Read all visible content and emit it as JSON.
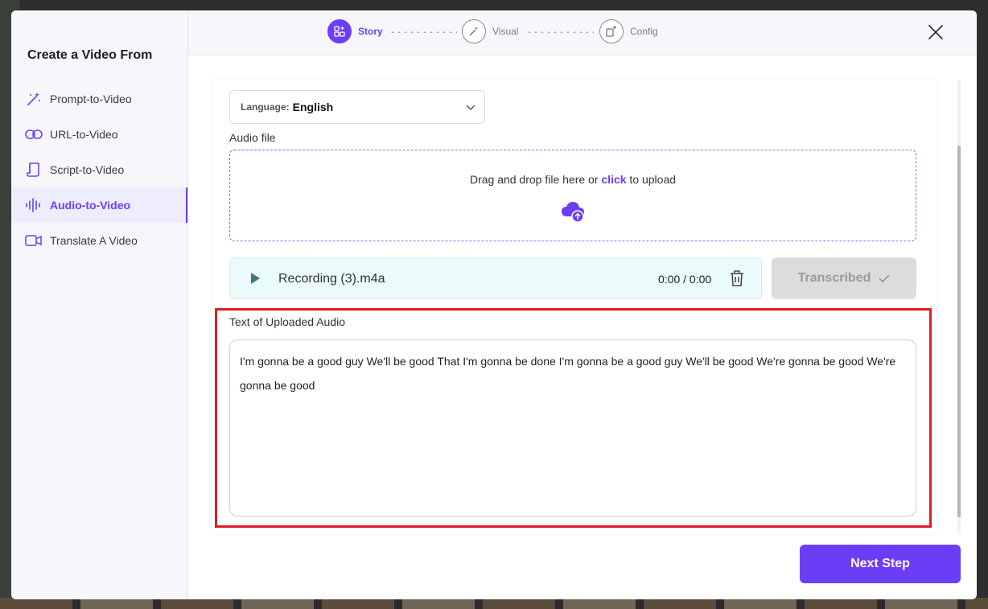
{
  "sidebar": {
    "title": "Create a Video From",
    "items": [
      {
        "label": "Prompt-to-Video",
        "icon": "magic-wand-icon"
      },
      {
        "label": "URL-to-Video",
        "icon": "link-icon"
      },
      {
        "label": "Script-to-Video",
        "icon": "scroll-icon"
      },
      {
        "label": "Audio-to-Video",
        "icon": "audio-wave-icon",
        "active": true
      },
      {
        "label": "Translate A Video",
        "icon": "video-camera-icon"
      }
    ]
  },
  "steps": [
    {
      "label": "Story",
      "icon": "story-icon",
      "active": true
    },
    {
      "label": "Visual",
      "icon": "visual-icon"
    },
    {
      "label": "Config",
      "icon": "config-icon"
    }
  ],
  "form": {
    "language_key": "Language:",
    "language_value": "English",
    "audio_file_label": "Audio file",
    "dropzone_text_before": "Drag and drop file here or ",
    "dropzone_click": "click",
    "dropzone_text_after": " to upload",
    "recording_name": "Recording (3).m4a",
    "recording_time": "0:00 / 0:00",
    "transcribed_label": "Transcribed",
    "text_label": "Text of Uploaded Audio",
    "transcript": "I'm gonna be a good guy We'll be good That I'm gonna be done I'm gonna be a good guy We'll be good We're gonna be good We're gonna be good"
  },
  "footer": {
    "next_label": "Next Step"
  },
  "colors": {
    "accent": "#6b3ef5",
    "highlight": "#e01b24",
    "player_bg": "#ebfafa"
  }
}
